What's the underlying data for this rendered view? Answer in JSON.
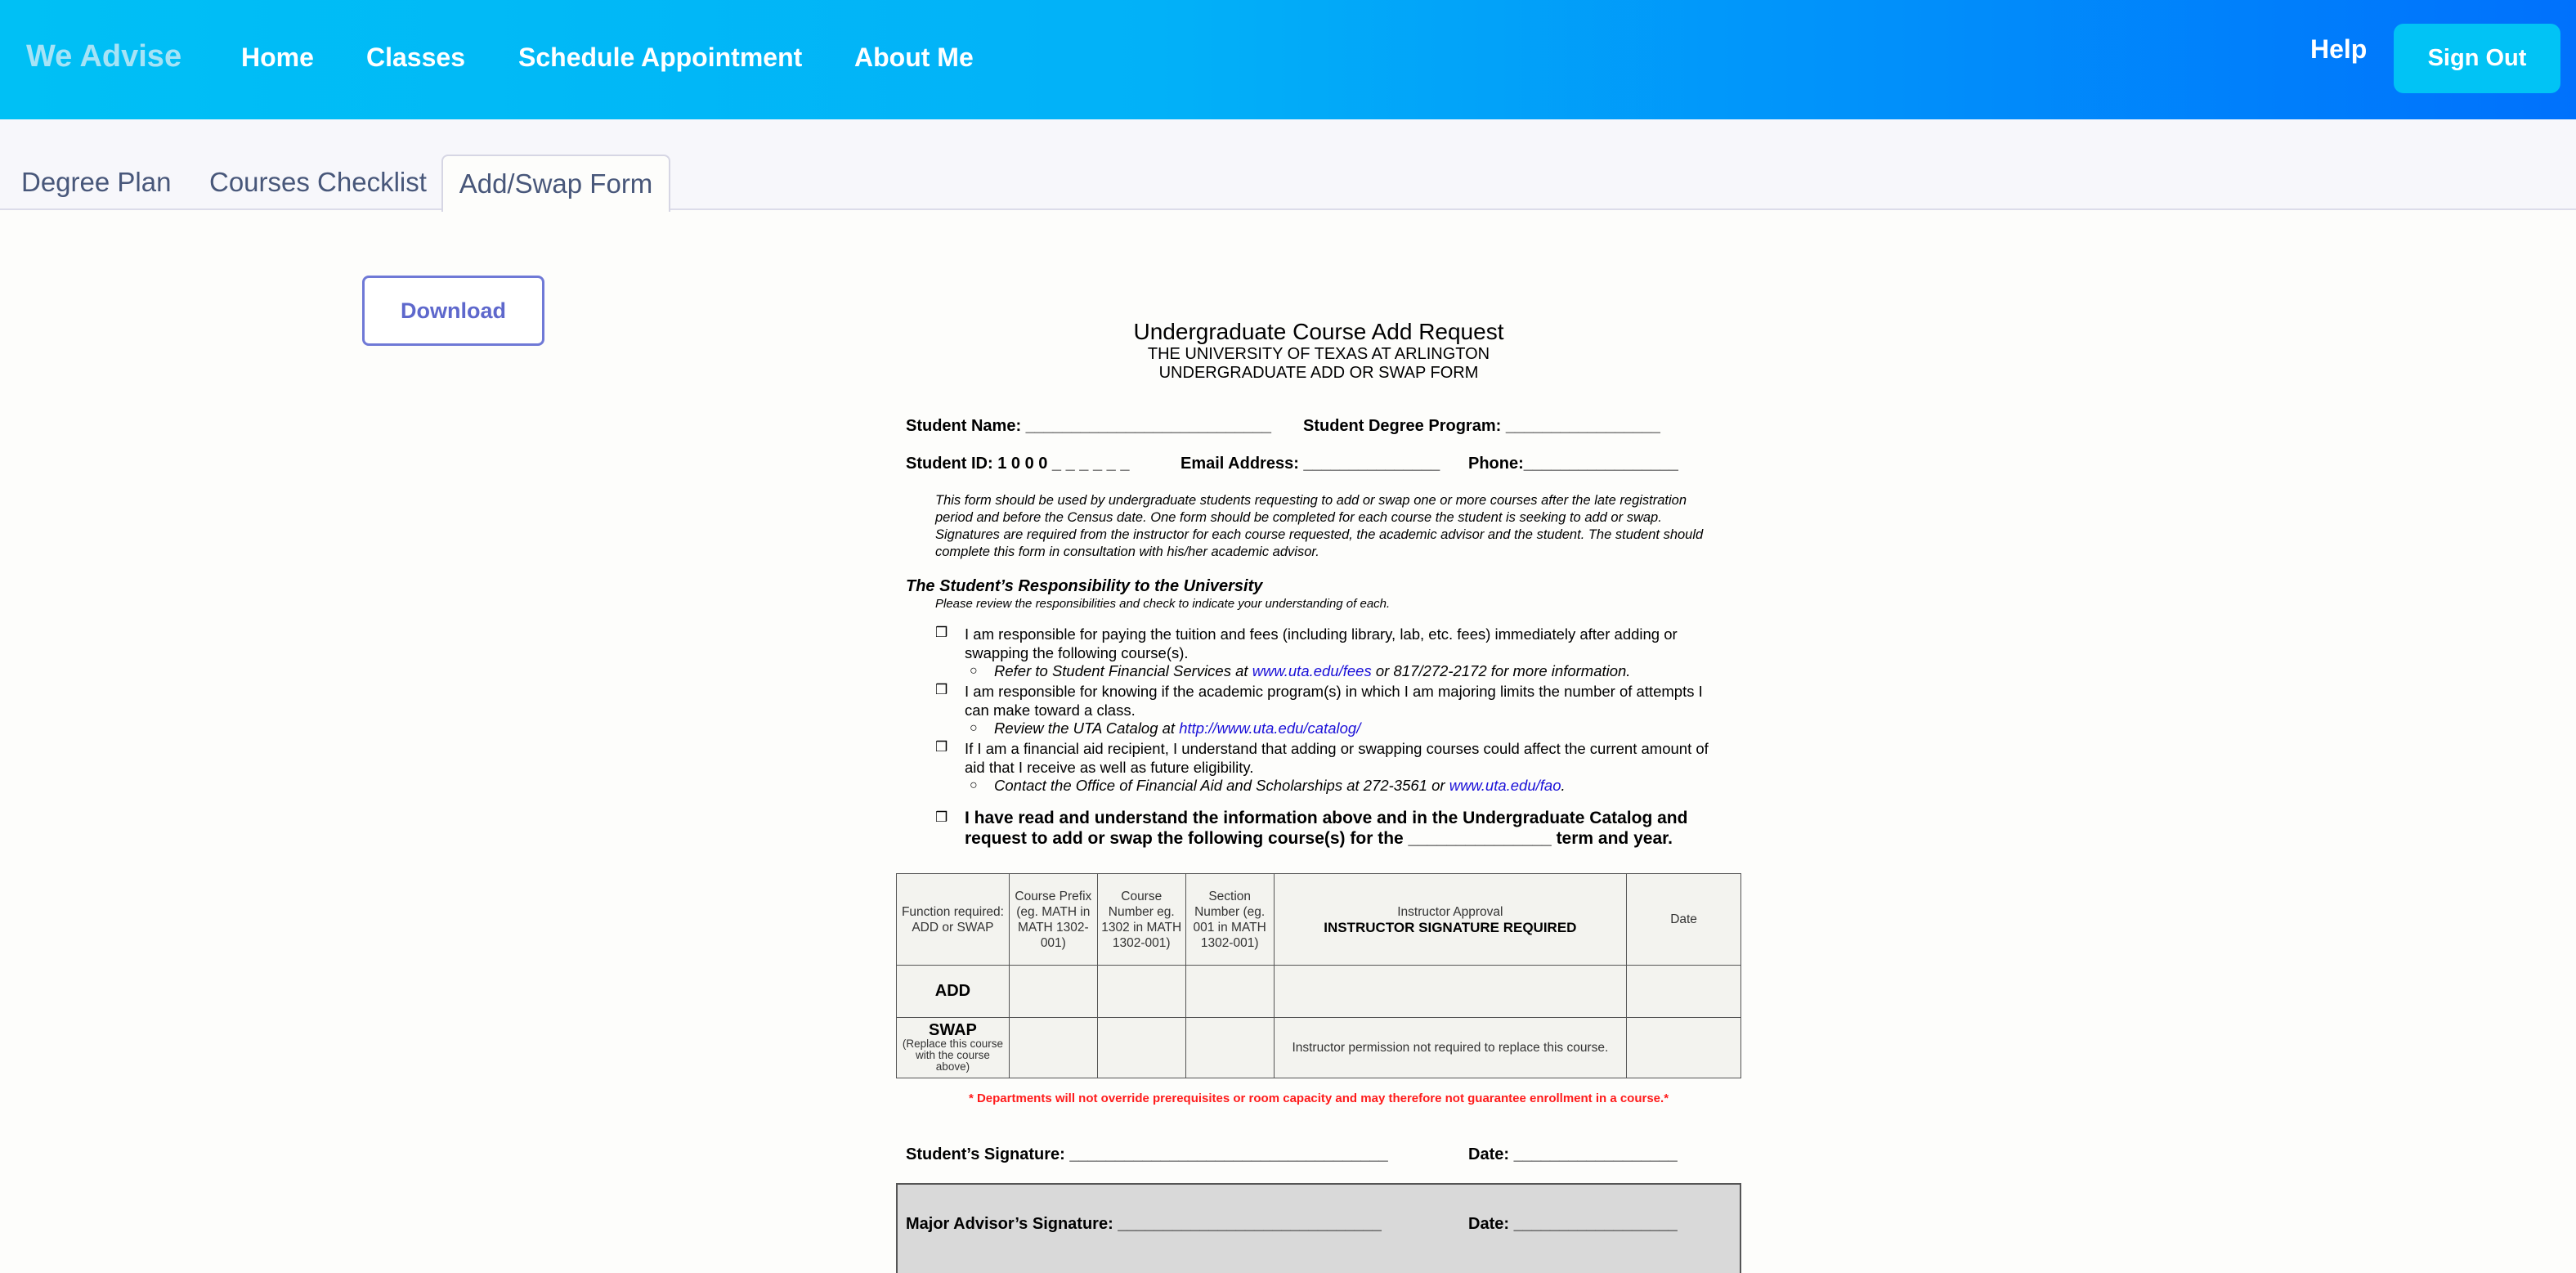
{
  "nav": {
    "brand": "We Advise",
    "links": [
      "Home",
      "Classes",
      "Schedule Appointment",
      "About Me"
    ],
    "help": "Help",
    "sign_out": "Sign Out"
  },
  "tabs": [
    "Degree Plan",
    "Courses Checklist",
    "Add/Swap Form"
  ],
  "download_label": "Download",
  "form": {
    "title": "Undergraduate Course Add Request",
    "university": "THE UNIVERSITY OF TEXAS AT ARLINGTON",
    "subtitle": "UNDERGRADUATE ADD OR SWAP FORM",
    "student_name": "Student Name: ___________________________",
    "degree_program": "Student Degree Program:  _________________",
    "student_id": "Student ID: 1  0  0  0  _  _  _  _  _  _",
    "email": "Email Address: _______________",
    "phone": "Phone:_________________",
    "intro": "This form should be used by undergraduate students requesting to add or swap one or more courses after the late registration period and before the Census date. One form should be completed for each course the student is seeking to add or swap. Signatures are required from the instructor for each course requested, the academic advisor and the student.  The student should complete this form in consultation with his/her academic advisor.",
    "resp_heading": "The Student’s Responsibility to the University",
    "resp_sub": "Please review the responsibilities and check to indicate your understanding of each.",
    "checkbox_glyph": "❒",
    "bullet_glyph": "○",
    "items": [
      {
        "text": "I am responsible for paying the tuition and fees (including library, lab, etc. fees) immediately after adding or swapping the following course(s).",
        "sub_pre": "Refer to Student Financial Services at ",
        "sub_link": "www.uta.edu/fees",
        "sub_post": " or 817/272-2172 for more information."
      },
      {
        "text": "I am responsible for knowing if the academic program(s) in which I am majoring limits the number of attempts I can make toward a class.",
        "sub_pre": "Review the UTA Catalog at ",
        "sub_link": "http://www.uta.edu/catalog/",
        "sub_post": ""
      },
      {
        "text": "If I am a financial aid recipient, I understand that adding or swapping courses could affect the current amount of aid that I receive as well as future eligibility.",
        "sub_pre": "Contact the Office of Financial Aid and Scholarships at 272-3561 or ",
        "sub_link": "www.uta.edu/fao",
        "sub_post": "."
      }
    ],
    "final_statement": "I have read and understand the information above and in the Undergraduate Catalog and request to add or swap the following course(s) for the _______________ term and year.",
    "table": {
      "headers": [
        "Function required: ADD or SWAP",
        "Course Prefix (eg. MATH in MATH 1302-001)",
        "Course Number eg. 1302 in MATH 1302-001)",
        "Section Number (eg. 001 in MATH 1302-001)",
        "Instructor Approval",
        "Date"
      ],
      "instructor_required": "INSTRUCTOR SIGNATURE REQUIRED",
      "row_add": "ADD",
      "row_swap": "SWAP",
      "swap_note": "(Replace this course with the course above)",
      "swap_instructor_note": "Instructor permission not required to replace this course."
    },
    "warning": "* Departments will not override prerequisites or room capacity and may therefore not guarantee enrollment in a course.*",
    "student_signature": "Student’s Signature: ___________________________________",
    "student_date": "Date: __________________",
    "advisor_signature": "Major Advisor’s Signature: _____________________________",
    "advisor_date": "Date: __________________"
  }
}
